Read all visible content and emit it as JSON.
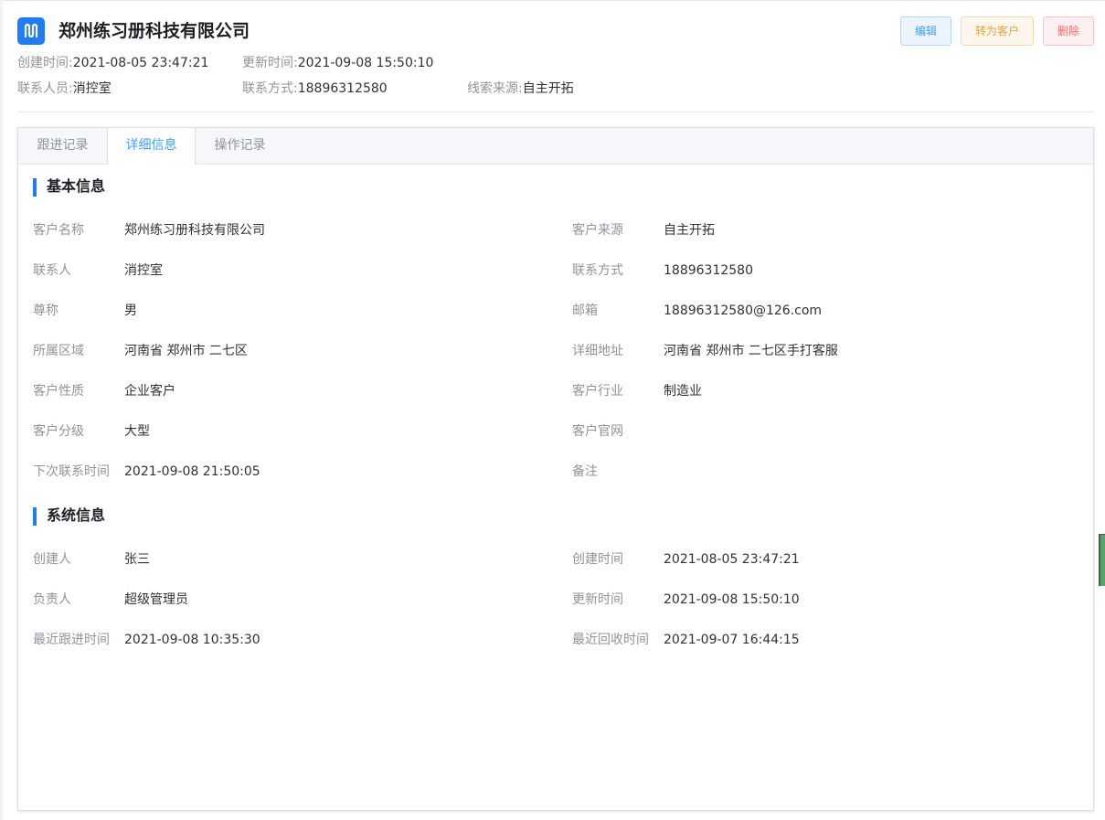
{
  "company": {
    "name": "郑州练习册科技有限公司"
  },
  "actions": {
    "edit": "编辑",
    "convert": "转为客户",
    "delete": "删除"
  },
  "meta": {
    "created_label": "创建时间:",
    "created_value": "2021-08-05 23:47:21",
    "updated_label": "更新时间:",
    "updated_value": "2021-09-08 15:50:10",
    "contact_label": "联系人员:",
    "contact_value": "消控室",
    "phone_label": "联系方式:",
    "phone_value": "18896312580",
    "source_label": "线索来源:",
    "source_value": "自主开拓"
  },
  "tabs": [
    {
      "label": "跟进记录"
    },
    {
      "label": "详细信息"
    },
    {
      "label": "操作记录"
    }
  ],
  "active_tab": "详细信息",
  "basic": {
    "title": "基本信息",
    "fields": [
      {
        "label": "客户名称",
        "value": "郑州练习册科技有限公司"
      },
      {
        "label": "客户来源",
        "value": "自主开拓"
      },
      {
        "label": "联系人",
        "value": "消控室"
      },
      {
        "label": "联系方式",
        "value": "18896312580"
      },
      {
        "label": "尊称",
        "value": "男"
      },
      {
        "label": "邮箱",
        "value": "18896312580@126.com"
      },
      {
        "label": "所属区域",
        "value": "河南省 郑州市 二七区"
      },
      {
        "label": "详细地址",
        "value": "河南省 郑州市 二七区手打客服"
      },
      {
        "label": "客户性质",
        "value": "企业客户"
      },
      {
        "label": "客户行业",
        "value": "制造业"
      },
      {
        "label": "客户分级",
        "value": "大型"
      },
      {
        "label": "客户官网",
        "value": ""
      },
      {
        "label": "下次联系时间",
        "value": "2021-09-08 21:50:05"
      },
      {
        "label": "备注",
        "value": ""
      }
    ]
  },
  "system": {
    "title": "系统信息",
    "fields": [
      {
        "label": "创建人",
        "value": "张三"
      },
      {
        "label": "创建时间",
        "value": "2021-08-05 23:47:21"
      },
      {
        "label": "负责人",
        "value": "超级管理员"
      },
      {
        "label": "更新时间",
        "value": "2021-09-08 15:50:10"
      },
      {
        "label": "最近跟进时间",
        "value": "2021-09-08 10:35:30"
      },
      {
        "label": "最近回收时间",
        "value": "2021-09-07 16:44:15"
      }
    ]
  },
  "colors": {
    "accent": "#1f7cf5",
    "edit": "#409eff",
    "convert": "#e6a23c",
    "delete": "#f56c6c"
  },
  "icons": {
    "logo": "app-logo-icon"
  }
}
